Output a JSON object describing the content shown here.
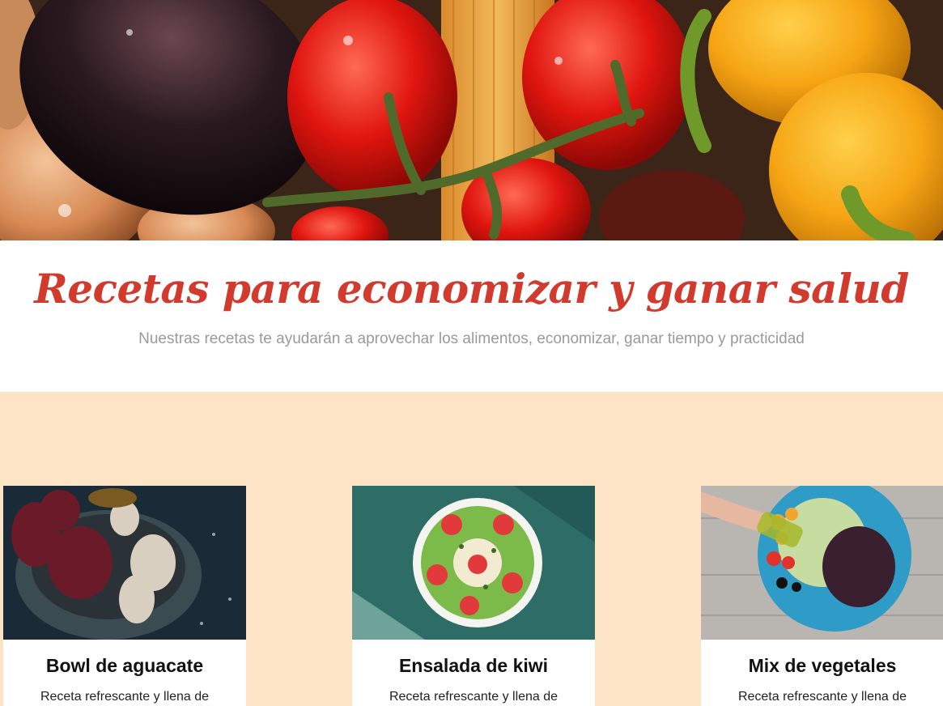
{
  "hero": {
    "alt": "vegetables-banner"
  },
  "header": {
    "title": "Recetas para economizar y ganar salud",
    "subtitle": "Nuestras recetas te ayudarán a aprovechar los alimentos, economizar, ganar tiempo y practicidad"
  },
  "recipes": [
    {
      "title": "Bowl de aguacate",
      "description": "Receta refrescante y llena de"
    },
    {
      "title": "Ensalada de kiwi",
      "description": "Receta refrescante y llena de"
    },
    {
      "title": "Mix de vegetales",
      "description": "Receta refrescante y llena de"
    }
  ],
  "colors": {
    "title": "#d13a2c",
    "subtitle": "#9a9a9a",
    "section_bg": "#fde4c7",
    "card_bg": "#ffffff"
  }
}
